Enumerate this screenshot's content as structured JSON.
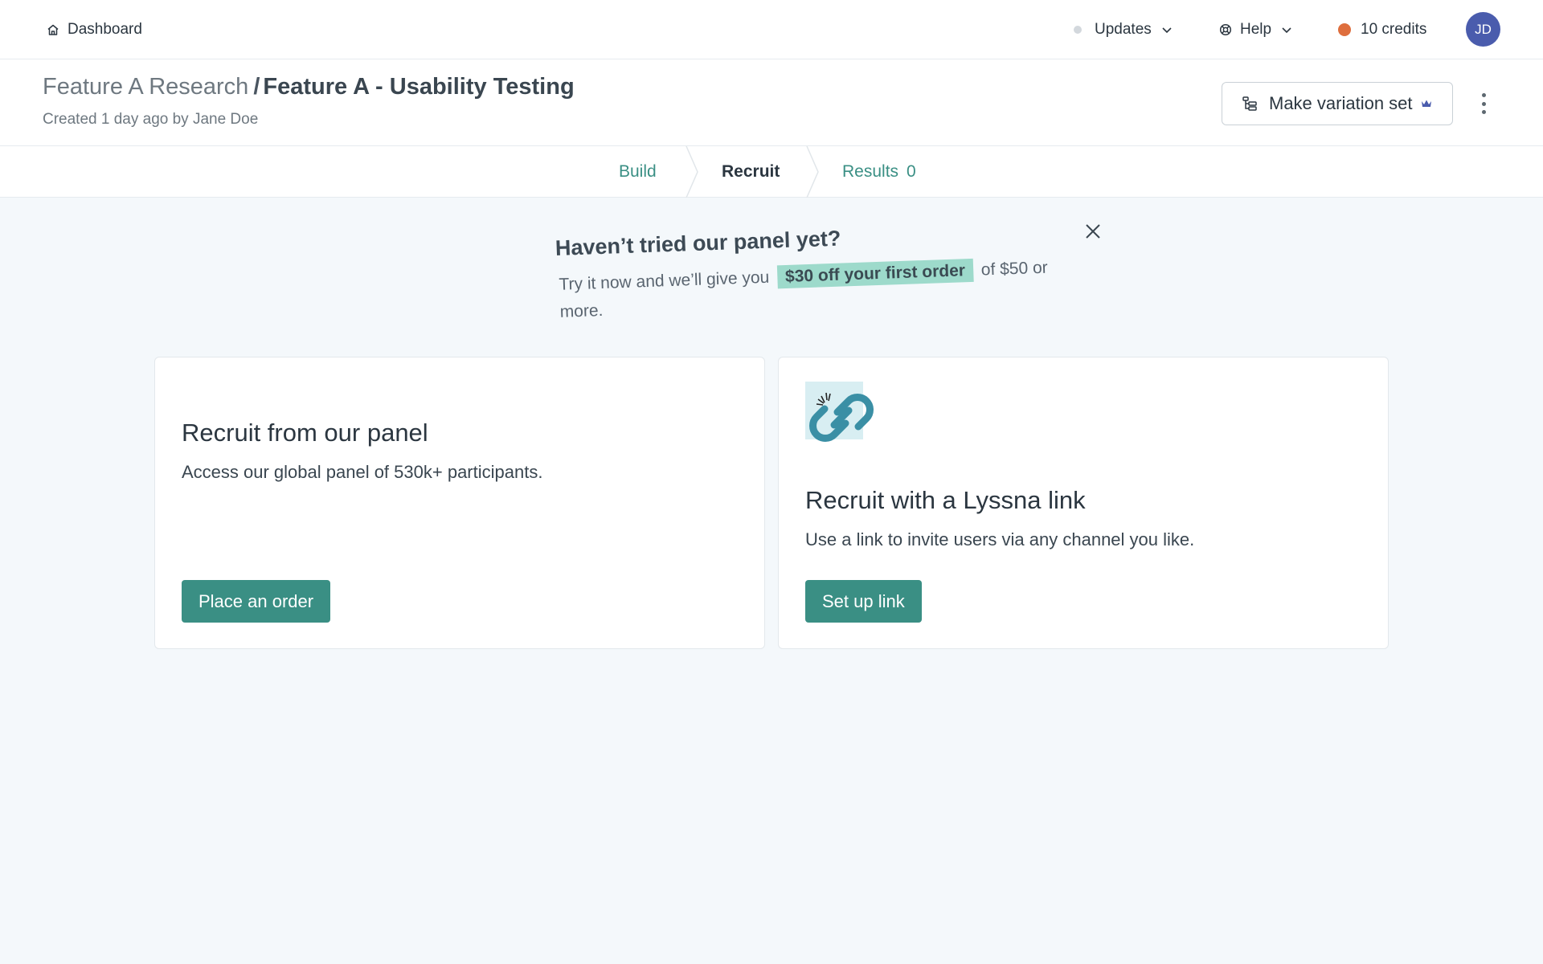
{
  "topbar": {
    "dashboard_label": "Dashboard",
    "updates_label": "Updates",
    "help_label": "Help",
    "credits_label": "10 credits",
    "avatar_initials": "JD"
  },
  "header": {
    "breadcrumb_parent": "Feature A Research",
    "breadcrumb_separator": "/",
    "breadcrumb_current": "Feature A - Usability Testing",
    "created_text": "Created 1 day ago by Jane Doe",
    "variation_button_label": "Make variation set"
  },
  "tabs": [
    {
      "label": "Build",
      "active": false
    },
    {
      "label": "Recruit",
      "active": true
    },
    {
      "label": "Results",
      "count": "0",
      "active": false
    }
  ],
  "promo": {
    "title": "Haven’t tried our panel yet?",
    "text_before": "Try it now and we’ll give you",
    "highlight": "$30 off your first order",
    "text_after": "of $50 or more."
  },
  "cards": {
    "panel": {
      "title": "Recruit from our panel",
      "description": "Access our global panel of 530k+ participants.",
      "button_label": "Place an order"
    },
    "link": {
      "title": "Recruit with a Lyssna link",
      "description": "Use a link to invite users via any channel you like.",
      "button_label": "Set up link"
    }
  },
  "colors": {
    "accent": "#3a8f84",
    "credit_dot": "#de6e3d",
    "avatar_bg": "#4a5cad",
    "highlight_bg": "#9ddacb",
    "page_bg": "#f4f8fb"
  },
  "icons": [
    "home-icon",
    "chevron-down-icon",
    "lifebuoy-icon",
    "variation-icon",
    "crown-icon",
    "kebab-icon",
    "close-icon",
    "link-illustration"
  ]
}
